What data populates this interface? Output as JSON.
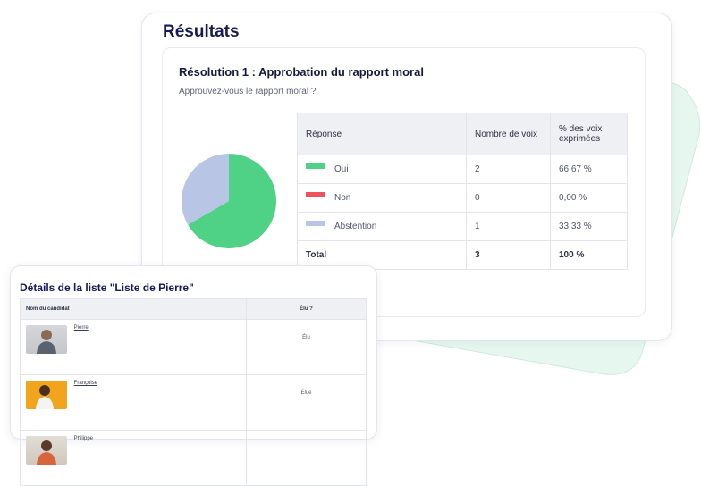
{
  "results": {
    "title": "Résultats",
    "resolution_title": "Résolution 1 : Approbation du rapport moral",
    "question": "Approuvez-vous le rapport moral ?",
    "table": {
      "headers": [
        "Réponse",
        "Nombre de voix",
        "% des voix exprimées"
      ],
      "rows": [
        {
          "label": "Oui",
          "count": "2",
          "pct": "66,67 %",
          "color": "#4fd186"
        },
        {
          "label": "Non",
          "count": "0",
          "pct": "0,00 %",
          "color": "#ee535d"
        },
        {
          "label": "Abstention",
          "count": "1",
          "pct": "33,33 %",
          "color": "#b8c5e5"
        }
      ],
      "total": {
        "label": "Total",
        "count": "3",
        "pct": "100 %"
      }
    }
  },
  "chart_data": {
    "type": "pie",
    "categories": [
      "Oui",
      "Non",
      "Abstention"
    ],
    "values": [
      66.67,
      0,
      33.33
    ],
    "colors": [
      "#4fd186",
      "#ee535d",
      "#b8c5e5"
    ]
  },
  "list_details": {
    "title": "Détails de la liste \"Liste de Pierre\"",
    "headers": [
      "Nom du candidat",
      "Élu ?"
    ],
    "candidates": [
      {
        "name": "Pierre",
        "elected": "Élu",
        "avatar_bg": "#c9ccd0",
        "linked": true
      },
      {
        "name": "Françoise",
        "elected": "Élue",
        "avatar_bg": "#f2a41c",
        "linked": true
      },
      {
        "name": "Philippe",
        "elected": "",
        "avatar_bg": "#d8d2cb",
        "linked": false
      }
    ]
  },
  "colors": {
    "accent_title": "#151a55",
    "decor_shape": "#e4f7ef"
  }
}
